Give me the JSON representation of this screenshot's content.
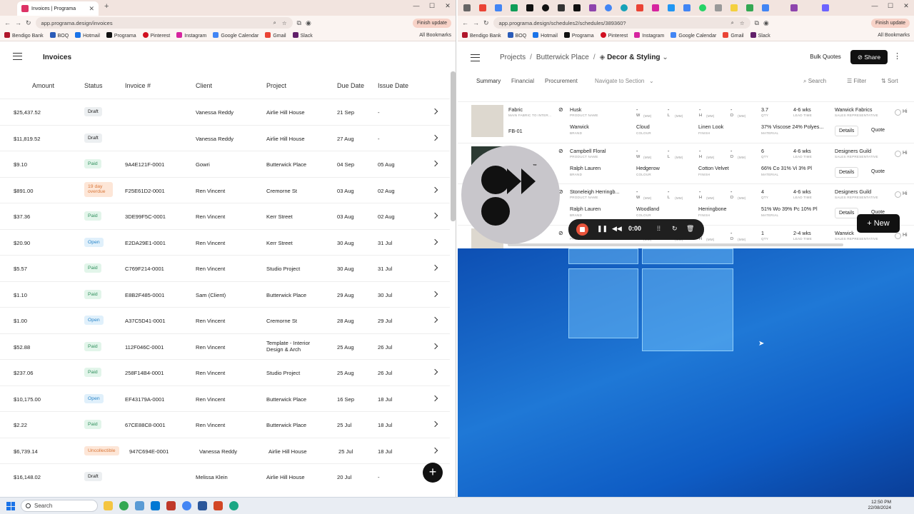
{
  "left_browser": {
    "tab_title": "Invoices | Programa",
    "url": "app.programa.design/invoices",
    "finish_update": "Finish update",
    "bookmarks": [
      "Bendigo Bank",
      "BOQ",
      "Hotmail",
      "Programa",
      "Pinterest",
      "Instagram",
      "Google Calendar",
      "Gmail",
      "Slack"
    ],
    "all_bookmarks": "All Bookmarks"
  },
  "right_browser": {
    "url": "app.programa.design/schedules2/schedules/389360?",
    "finish_update": "Finish update",
    "bookmarks": [
      "Bendigo Bank",
      "BOQ",
      "Hotmail",
      "Programa",
      "Pinterest",
      "Instagram",
      "Google Calendar",
      "Gmail",
      "Slack"
    ],
    "all_bookmarks": "All Bookmarks"
  },
  "invoices": {
    "title": "Invoices",
    "columns": [
      "Amount",
      "Status",
      "Invoice #",
      "Client",
      "Project",
      "Due Date",
      "Issue Date"
    ],
    "rows": [
      {
        "amount": "$25,437.52",
        "status": "Draft",
        "kind": "draft",
        "invoice": "",
        "client": "Vanessa Reddy",
        "project": "Airlie Hill House",
        "due": "21 Sep",
        "issue": "-"
      },
      {
        "amount": "$11,819.52",
        "status": "Draft",
        "kind": "draft",
        "invoice": "",
        "client": "Vanessa Reddy",
        "project": "Airlie Hill House",
        "due": "27 Aug",
        "issue": "-"
      },
      {
        "amount": "$9.10",
        "status": "Paid",
        "kind": "paid",
        "invoice": "9A4E121F-0001",
        "client": "Gowri",
        "project": "Butterwick Place",
        "due": "04 Sep",
        "issue": "05 Aug"
      },
      {
        "amount": "$891.00",
        "status": "19 day overdue",
        "kind": "overdue",
        "invoice": "F25E61D2-0001",
        "client": "Ren Vincent",
        "project": "Cremorne St",
        "due": "03 Aug",
        "issue": "02 Aug"
      },
      {
        "amount": "$37.36",
        "status": "Paid",
        "kind": "paid",
        "invoice": "3DE99F5C-0001",
        "client": "Ren Vincent",
        "project": "Kerr Street",
        "due": "03 Aug",
        "issue": "02 Aug"
      },
      {
        "amount": "$20.90",
        "status": "Open",
        "kind": "open",
        "invoice": "E2DA29E1-0001",
        "client": "Ren Vincent",
        "project": "Kerr Street",
        "due": "30 Aug",
        "issue": "31 Jul"
      },
      {
        "amount": "$5.57",
        "status": "Paid",
        "kind": "paid",
        "invoice": "C769F214-0001",
        "client": "Ren Vincent",
        "project": "Studio Project",
        "due": "30 Aug",
        "issue": "31 Jul"
      },
      {
        "amount": "$1.10",
        "status": "Paid",
        "kind": "paid",
        "invoice": "E8B2F485-0001",
        "client": "Sam (Client)",
        "project": "Butterwick Place",
        "due": "29 Aug",
        "issue": "30 Jul"
      },
      {
        "amount": "$1.00",
        "status": "Open",
        "kind": "open",
        "invoice": "A37C5D41-0001",
        "client": "Ren Vincent",
        "project": "Cremorne St",
        "due": "28 Aug",
        "issue": "29 Jul"
      },
      {
        "amount": "$52.88",
        "status": "Paid",
        "kind": "paid",
        "invoice": "112F046C-0001",
        "client": "Ren Vincent",
        "project": "Template - Interior Design & Arch",
        "due": "25 Aug",
        "issue": "26 Jul"
      },
      {
        "amount": "$237.06",
        "status": "Paid",
        "kind": "paid",
        "invoice": "258F14B4-0001",
        "client": "Ren Vincent",
        "project": "Studio Project",
        "due": "25 Aug",
        "issue": "26 Jul"
      },
      {
        "amount": "$10,175.00",
        "status": "Open",
        "kind": "open",
        "invoice": "EF43179A-0001",
        "client": "Ren Vincent",
        "project": "Butterwick Place",
        "due": "16 Sep",
        "issue": "18 Jul"
      },
      {
        "amount": "$2.22",
        "status": "Paid",
        "kind": "paid",
        "invoice": "67CE88C8-0001",
        "client": "Ren Vincent",
        "project": "Butterwick Place",
        "due": "25 Jul",
        "issue": "18 Jul"
      },
      {
        "amount": "$6,739.14",
        "status": "Uncollectible",
        "kind": "uncollectible",
        "invoice": "947C694E-0001",
        "client": "Vanessa Reddy",
        "project": "Airlie Hill House",
        "due": "25 Jul",
        "issue": "18 Jul"
      },
      {
        "amount": "$16,148.02",
        "status": "Draft",
        "kind": "draft",
        "invoice": "",
        "client": "Melissa Klein",
        "project": "Airlie Hill House",
        "due": "20 Jul",
        "issue": "-"
      }
    ]
  },
  "schedule": {
    "breadcrumb": [
      "Projects",
      "Butterwick Place",
      "Decor & Styling"
    ],
    "bulk_quotes": "Bulk Quotes",
    "share": "Share",
    "tabs": [
      "Summary",
      "Financial",
      "Procurement",
      "Navigate to Section"
    ],
    "search": "Search",
    "filter": "Filter",
    "sort": "Sort",
    "new_button": "New",
    "captions": {
      "product_name": "PRODUCT NAME",
      "brand": "BRAND",
      "colour": "COLOUR",
      "finish": "FINISH",
      "material": "MATERIAL",
      "qty": "QTY",
      "lead_time": "LEAD TIME",
      "sales_rep": "SALES REPRESENTATIVE",
      "w": "W",
      "l": "L",
      "h": "H",
      "d": "D",
      "mm": "(MM)",
      "details": "Details",
      "quote": "Quote",
      "hi": "Hi"
    },
    "items": [
      {
        "category": "Fabric",
        "subcategory": "MAIN FABRIC TO INTER...",
        "code": "FB-01",
        "product": "Husk",
        "brand": "Warwick",
        "colour": "Cloud",
        "finish": "Linen Look",
        "material": "37% Viscose 24% Polyes...",
        "qty": "3.7",
        "lead": "4-6 wks",
        "supplier": "Warwick Fabrics"
      },
      {
        "category": "",
        "subcategory": "",
        "code": "",
        "product": "Campbell Floral",
        "brand": "Ralph Lauren",
        "colour": "Hedgerow",
        "finish": "Cotton Velvet",
        "material": "66% Co 31% Vi 3% Pl",
        "qty": "6",
        "lead": "4-6 wks",
        "supplier": "Designers Guild"
      },
      {
        "category": "",
        "subcategory": "",
        "code": "",
        "product": "Stoneleigh Herringb...",
        "brand": "Ralph Lauren",
        "colour": "Woodland",
        "finish": "Herringbone",
        "material": "51% Wo 39% Pc 10% Pl",
        "qty": "4",
        "lead": "4-6 wks",
        "supplier": "Designers Guild"
      },
      {
        "category": "",
        "subcategory": "",
        "code": "",
        "product": "",
        "brand": "",
        "colour": "",
        "finish": "",
        "material": "",
        "qty": "1",
        "lead": "2-4 wks",
        "supplier": "Warwick"
      }
    ],
    "dash": "-"
  },
  "recorder": {
    "time": "0:00"
  },
  "taskbar": {
    "search": "Search",
    "time": "12:50 PM",
    "date": "22/08/2024"
  }
}
